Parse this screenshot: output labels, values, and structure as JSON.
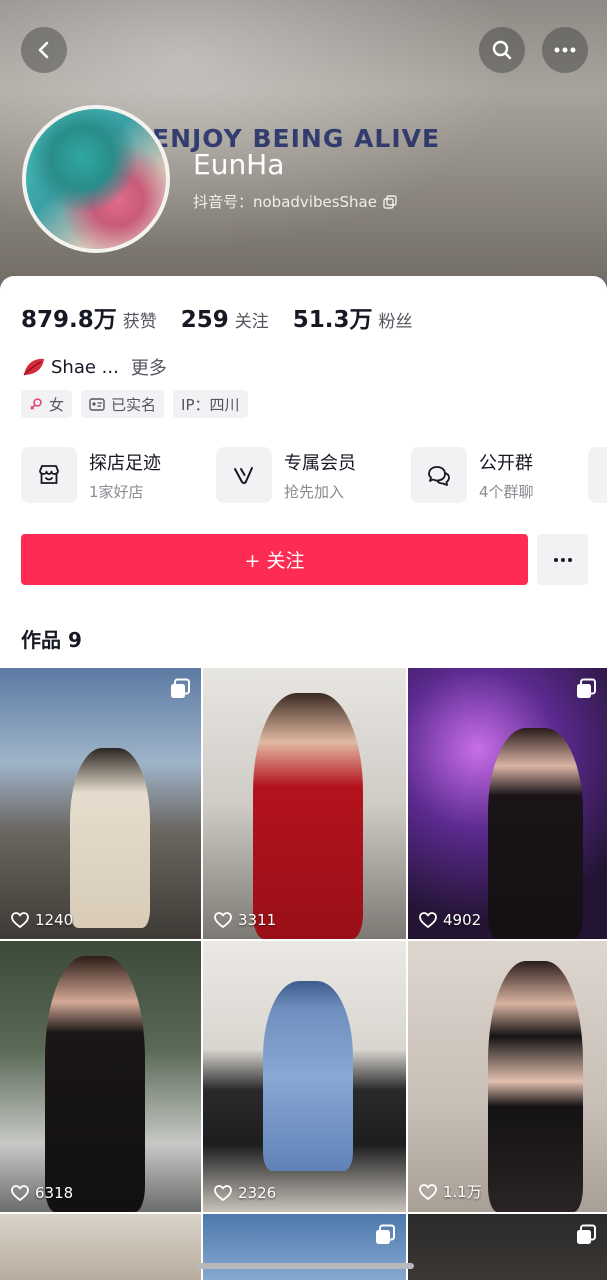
{
  "header": {
    "banner_text": "ENJOY BEING ALIVE",
    "nickname": "EunHa",
    "douyin_id": "抖音号：nobadvibesShae",
    "icons": {
      "back": "back-arrow-icon",
      "search": "search-icon",
      "more": "more-dots-icon",
      "copy": "copy-icon"
    }
  },
  "stats": [
    {
      "value": "879.8万",
      "label": "获赞"
    },
    {
      "value": "259",
      "label": "关注"
    },
    {
      "value": "51.3万",
      "label": "粉丝"
    }
  ],
  "bio": {
    "text": "Shae ...",
    "more": "更多"
  },
  "tags": [
    {
      "icon": "female-icon",
      "label": "女"
    },
    {
      "icon": "id-card-icon",
      "label": "已实名"
    },
    {
      "icon": "",
      "label": "IP：四川"
    }
  ],
  "services": [
    {
      "icon": "store-icon",
      "title": "探店足迹",
      "subtitle": "1家好店"
    },
    {
      "icon": "vip-icon",
      "title": "专属会员",
      "subtitle": "抢先加入"
    },
    {
      "icon": "group-chat-icon",
      "title": "公开群",
      "subtitle": "4个群聊"
    }
  ],
  "actions": {
    "follow_label": "+ 关注"
  },
  "works": {
    "title": "作品 9"
  },
  "videos": [
    {
      "likes": "1240",
      "multi": true
    },
    {
      "likes": "3311",
      "multi": false
    },
    {
      "likes": "4902",
      "multi": true
    },
    {
      "likes": "6318",
      "multi": false
    },
    {
      "likes": "2326",
      "multi": false
    },
    {
      "likes": "1.1万",
      "multi": false
    },
    {
      "likes": "",
      "multi": false
    },
    {
      "likes": "",
      "multi": true
    },
    {
      "likes": "",
      "multi": true
    }
  ],
  "colors": {
    "accent": "#fe2c55",
    "text": "#161823",
    "secondary": "#55565e"
  }
}
